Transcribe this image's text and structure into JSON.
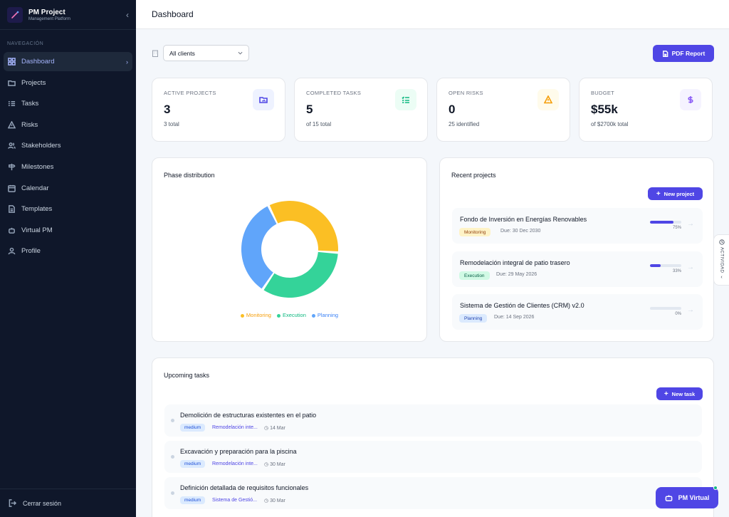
{
  "brand": {
    "name": "PM Project",
    "subtitle": "Management Platform"
  },
  "sidebar": {
    "section": "NAVEGACIÓN",
    "items": [
      {
        "label": "Dashboard",
        "icon": "grid-icon",
        "active": true
      },
      {
        "label": "Projects",
        "icon": "folder-icon"
      },
      {
        "label": "Tasks",
        "icon": "list-icon"
      },
      {
        "label": "Risks",
        "icon": "warning-icon"
      },
      {
        "label": "Stakeholders",
        "icon": "users-icon"
      },
      {
        "label": "Milestones",
        "icon": "signpost-icon"
      },
      {
        "label": "Calendar",
        "icon": "calendar-icon"
      },
      {
        "label": "Templates",
        "icon": "file-icon"
      },
      {
        "label": "Virtual PM",
        "icon": "bot-icon"
      },
      {
        "label": "Profile",
        "icon": "user-icon"
      }
    ],
    "logout": "Cerrar sesión"
  },
  "header": {
    "title": "Dashboard"
  },
  "filter": {
    "client": "All clients"
  },
  "pdf_button": "PDF Report",
  "kpis": [
    {
      "label": "ACTIVE PROJECTS",
      "value": "3",
      "sub": "3 total",
      "icon": "folder-chart-icon",
      "color": "#4f46e5",
      "bg": "#eef2ff"
    },
    {
      "label": "COMPLETED TASKS",
      "value": "5",
      "sub": "of 15 total",
      "icon": "checklist-icon",
      "color": "#10b981",
      "bg": "#ecfdf5"
    },
    {
      "label": "OPEN RISKS",
      "value": "0",
      "sub": "25 identified",
      "icon": "warning-icon",
      "color": "#f59e0b",
      "bg": "#fffbeb"
    },
    {
      "label": "BUDGET",
      "value": "$55k",
      "sub": "of $2700k total",
      "icon": "dollar-icon",
      "color": "#8b5cf6",
      "bg": "#f5f3ff"
    }
  ],
  "phase": {
    "title": "Phase distribution",
    "legend": [
      "Monitoring",
      "Execution",
      "Planning"
    ]
  },
  "chart_data": {
    "type": "pie",
    "donut": true,
    "categories": [
      "Monitoring",
      "Execution",
      "Planning"
    ],
    "values": [
      1,
      1,
      1
    ],
    "colors": [
      "#fbbf24",
      "#34d399",
      "#60a5fa"
    ],
    "legend_position": "bottom"
  },
  "recent": {
    "title": "Recent projects",
    "new_button": "New project",
    "projects": [
      {
        "title": "Fondo de Inversión en Energías Renovables",
        "phase": "Monitoring",
        "due": "Due: 30 Dec 2030",
        "progress": 75,
        "pct": "75%",
        "tag_bg": "#fef3c7",
        "tag_fg": "#92400e"
      },
      {
        "title": "Remodelación integral de patio trasero",
        "phase": "Execution",
        "due": "Due: 29 May 2026",
        "progress": 33,
        "pct": "33%",
        "tag_bg": "#d1fae5",
        "tag_fg": "#065f46"
      },
      {
        "title": "Sistema de Gestión de Clientes (CRM) v2.0",
        "phase": "Planning",
        "due": "Due: 14 Sep 2026",
        "progress": 0,
        "pct": "0%",
        "tag_bg": "#dbeafe",
        "tag_fg": "#1e40af"
      }
    ]
  },
  "tasks": {
    "title": "Upcoming tasks",
    "new_button": "New task",
    "items": [
      {
        "title": "Demolición de estructuras existentes en el patio",
        "priority": "medium",
        "project": "Remodelación inte...",
        "date": "14 Mar"
      },
      {
        "title": "Excavación y preparación para la piscina",
        "priority": "medium",
        "project": "Remodelación inte...",
        "date": "30 Mar"
      },
      {
        "title": "Definición detallada de requisitos funcionales",
        "priority": "medium",
        "project": "Sistema de Gestió...",
        "date": "30 Mar"
      }
    ]
  },
  "activity_tab": "ACTIVIDAD",
  "virtual_button": "PM Virtual"
}
